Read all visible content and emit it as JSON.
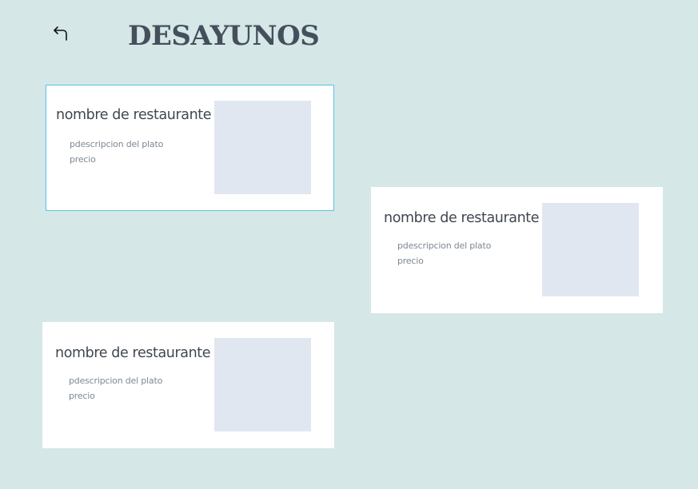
{
  "header": {
    "back_icon": "return-arrow-icon",
    "title": "DESAYUNOS"
  },
  "cards": [
    {
      "name": "nombre de restaurante",
      "description": "pdescripcion del plato",
      "price": "precio",
      "selected": true
    },
    {
      "name": "nombre de restaurante",
      "description": "pdescripcion del plato",
      "price": "precio",
      "selected": false
    },
    {
      "name": "nombre de restaurante",
      "description": "pdescripcion del plato",
      "price": "precio",
      "selected": false
    }
  ],
  "colors": {
    "background": "#d5e7e6",
    "title": "#454f5c",
    "card": "#ffffff",
    "selected_border": "#5bc0e6",
    "image_placeholder": "#e1e7f0"
  }
}
